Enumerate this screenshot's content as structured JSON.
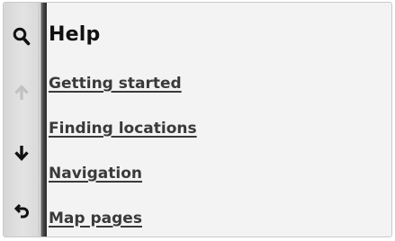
{
  "header": {
    "title": "Help"
  },
  "menu": {
    "items": [
      {
        "label": "Getting started"
      },
      {
        "label": "Finding locations"
      },
      {
        "label": "Navigation"
      },
      {
        "label": "Map pages"
      }
    ]
  },
  "sidebar": {
    "buttons": [
      {
        "icon": "search-icon",
        "state": "enabled"
      },
      {
        "icon": "arrow-up-icon",
        "state": "disabled"
      },
      {
        "icon": "arrow-down-icon",
        "state": "enabled"
      },
      {
        "icon": "back-icon",
        "state": "enabled"
      }
    ]
  },
  "colors": {
    "icon_enabled": "#111111",
    "icon_disabled": "#c2c2c2",
    "link_text": "#3a3a3a",
    "title_text": "#111111",
    "content_bg": "#f3f3f3",
    "sidebar_bg": "#dcdcdc"
  }
}
